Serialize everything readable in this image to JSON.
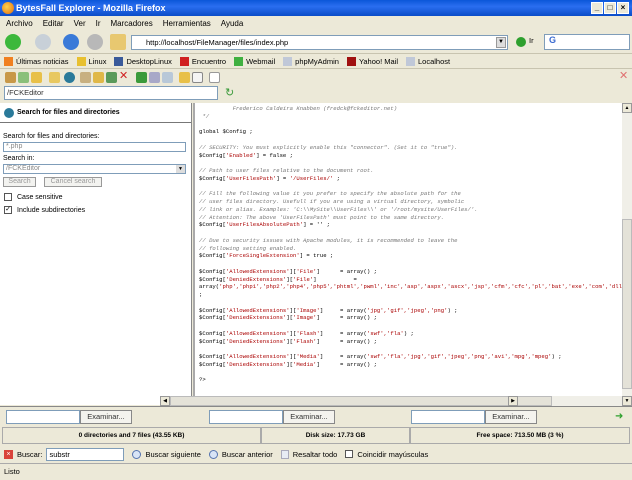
{
  "window": {
    "title": "BytesFall Explorer - Mozilla Firefox",
    "min": "_",
    "max": "□",
    "close": "×"
  },
  "menu": [
    "Archivo",
    "Editar",
    "Ver",
    "Ir",
    "Marcadores",
    "Herramientas",
    "Ayuda"
  ],
  "nav": {
    "url": "http://localhost/FileManager/files/index.php",
    "go_label": "Ir",
    "search_placeholder": "G"
  },
  "bookmarks": [
    {
      "label": "Últimas noticias",
      "color": "#f08020"
    },
    {
      "label": "Linux",
      "color": "#e8c030"
    },
    {
      "label": "DesktopLinux",
      "color": "#3a5a9a"
    },
    {
      "label": "Encuentro",
      "color": "#d02020"
    },
    {
      "label": "Webmail",
      "color": "#40b040"
    },
    {
      "label": "phpMyAdmin",
      "color": "#c0c8d8"
    },
    {
      "label": "Yahoo! Mail",
      "color": "#a01010"
    },
    {
      "label": "Localhost",
      "color": "#c0c8d8"
    }
  ],
  "path": {
    "value": "/FCKEditor"
  },
  "search_panel": {
    "title": "Search for files and directories",
    "label_query": "Search for files and directories:",
    "query": "*.php",
    "label_in": "Search in:",
    "in_value": "/FCKEditor",
    "search_btn": "Search",
    "cancel_btn": "Cancel search",
    "case_label": "Case sensitive",
    "case_checked": false,
    "subdirs_label": "Include subdirectories",
    "subdirs_checked": true
  },
  "code_lines": [
    [
      [
        "          Frederico Caldeira Knabben (fredck@fckeditor.net)",
        "c"
      ]
    ],
    [
      [
        " */",
        "c"
      ]
    ],
    [],
    [
      [
        "global $Config ;",
        ""
      ]
    ],
    [],
    [
      [
        "// SECURITY: You must explicitly enable this \"connector\". (Set it to \"true\").",
        "c"
      ]
    ],
    [
      [
        "$Config[",
        ""
      ],
      [
        "'Enabled'",
        "s"
      ],
      [
        "] = false ;",
        ""
      ]
    ],
    [],
    [
      [
        "// Path to user files relative to the document root.",
        "c"
      ]
    ],
    [
      [
        "$Config[",
        ""
      ],
      [
        "'UserFilesPath'",
        "s"
      ],
      [
        "] = ",
        ""
      ],
      [
        "'/UserFiles/'",
        "s"
      ],
      [
        " ;",
        ""
      ]
    ],
    [],
    [
      [
        "// Fill the following value it you prefer to specify the absolute path for the",
        "c"
      ]
    ],
    [
      [
        "// user files directory. Usefull if you are using a virtual directory, symbolic",
        "c"
      ]
    ],
    [
      [
        "// link or alias. Examples: 'C:\\\\MySite\\\\UserFiles\\\\' or '/root/mysite/UserFiles/'.",
        "c"
      ]
    ],
    [
      [
        "// Attention: The above 'UserFilesPath' must point to the same directory.",
        "c"
      ]
    ],
    [
      [
        "$Config[",
        ""
      ],
      [
        "'UserFilesAbsolutePath'",
        "s"
      ],
      [
        "] = '' ;",
        ""
      ]
    ],
    [],
    [
      [
        "// Due to security issues with Apache modules, it is recommended to leave the",
        "c"
      ]
    ],
    [
      [
        "// following setting enabled.",
        "c"
      ]
    ],
    [
      [
        "$Config[",
        ""
      ],
      [
        "'ForceSingleExtension'",
        "s"
      ],
      [
        "] = true ;",
        ""
      ]
    ],
    [],
    [
      [
        "$Config[",
        ""
      ],
      [
        "'AllowedExtensions'",
        "s"
      ],
      [
        "][",
        ""
      ],
      [
        "'File'",
        "s"
      ],
      [
        "]      = array() ;",
        ""
      ]
    ],
    [
      [
        "$Config[",
        ""
      ],
      [
        "'DeniedExtensions'",
        "s"
      ],
      [
        "][",
        ""
      ],
      [
        "'File'",
        "s"
      ],
      [
        "]           =",
        ""
      ]
    ],
    [
      [
        "array(",
        ""
      ],
      [
        "'php','php1','php2','php4','php5','phtml','pwml','inc','asp','aspx','ascx','jsp','cfm','cfc','pl','bat','exe','com','dll','vbs','",
        "s"
      ]
    ],
    [
      [
        ";",
        ""
      ]
    ],
    [],
    [
      [
        "$Config[",
        ""
      ],
      [
        "'AllowedExtensions'",
        "s"
      ],
      [
        "][",
        ""
      ],
      [
        "'Image'",
        "s"
      ],
      [
        "]     = array(",
        ""
      ],
      [
        "'jpg','gif','jpeg','png'",
        "s"
      ],
      [
        ") ;",
        ""
      ]
    ],
    [
      [
        "$Config[",
        ""
      ],
      [
        "'DeniedExtensions'",
        "s"
      ],
      [
        "][",
        ""
      ],
      [
        "'Image'",
        "s"
      ],
      [
        "]      = array() ;",
        ""
      ]
    ],
    [],
    [
      [
        "$Config[",
        ""
      ],
      [
        "'AllowedExtensions'",
        "s"
      ],
      [
        "][",
        ""
      ],
      [
        "'Flash'",
        "s"
      ],
      [
        "]     = array(",
        ""
      ],
      [
        "'swf','fla'",
        "s"
      ],
      [
        ") ;",
        ""
      ]
    ],
    [
      [
        "$Config[",
        ""
      ],
      [
        "'DeniedExtensions'",
        "s"
      ],
      [
        "][",
        ""
      ],
      [
        "'Flash'",
        "s"
      ],
      [
        "]      = array() ;",
        ""
      ]
    ],
    [],
    [
      [
        "$Config[",
        ""
      ],
      [
        "'AllowedExtensions'",
        "s"
      ],
      [
        "][",
        ""
      ],
      [
        "'Media'",
        "s"
      ],
      [
        "]     = array(",
        ""
      ],
      [
        "'swf','fla','jpg','gif','jpeg','png','avi','mpg','mpeg'",
        "s"
      ],
      [
        ") ;",
        ""
      ]
    ],
    [
      [
        "$Config[",
        ""
      ],
      [
        "'DeniedExtensions'",
        "s"
      ],
      [
        "][",
        ""
      ],
      [
        "'Media'",
        "s"
      ],
      [
        "]      = array() ;",
        ""
      ]
    ],
    [],
    [
      [
        "?>",
        ""
      ]
    ]
  ],
  "upload": {
    "browse_label": "Examinar..."
  },
  "info": {
    "files": "0 directories and 7 files (43.55 KB)",
    "disk": "Disk size: 17.73 GB",
    "free": "Free space: 713.50 MB (3 %)"
  },
  "findbar": {
    "label": "Buscar:",
    "value": "substr",
    "next": "Buscar siguiente",
    "prev": "Buscar anterior",
    "highlight": "Resaltar todo",
    "match_case": "Coincidir mayúsculas"
  },
  "status": "Listo"
}
